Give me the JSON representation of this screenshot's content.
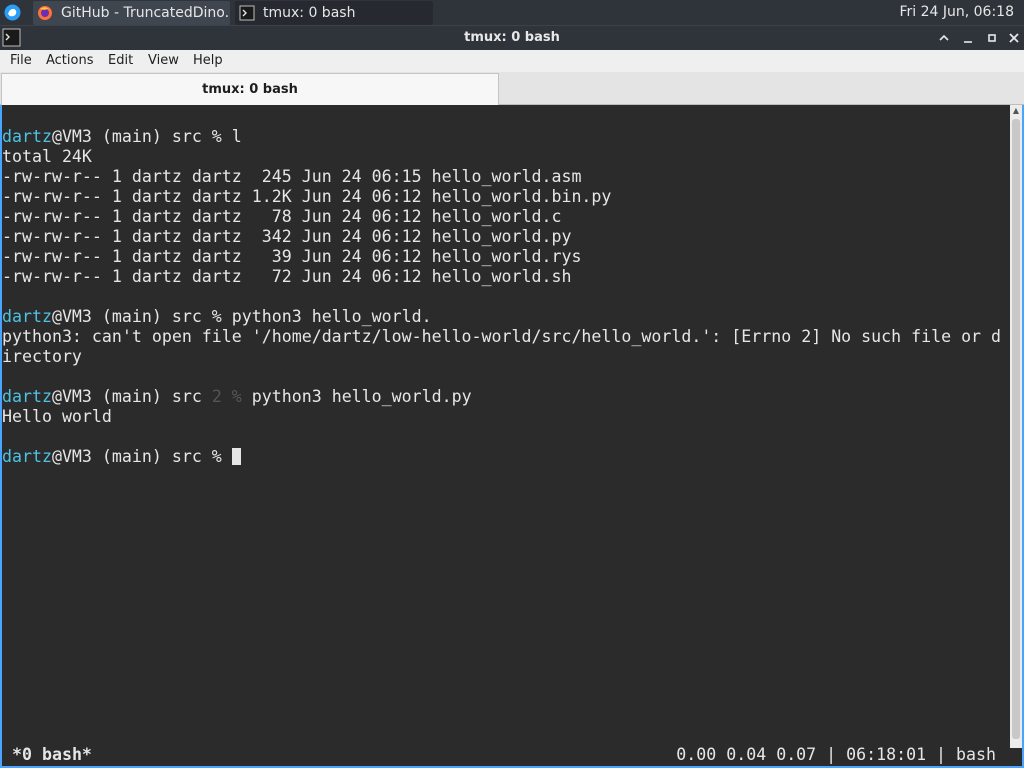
{
  "panel": {
    "tasks": [
      {
        "label": "GitHub - TruncatedDino...",
        "icon": "firefox-icon"
      },
      {
        "label": "tmux: 0 bash",
        "icon": "terminal-icon"
      }
    ],
    "clock": "Fri 24 Jun, 06:18"
  },
  "window": {
    "title": "tmux: 0 bash"
  },
  "menubar": {
    "items": [
      "File",
      "Actions",
      "Edit",
      "View",
      "Help"
    ]
  },
  "tabs": [
    {
      "label": "tmux: 0 bash",
      "active": true
    }
  ],
  "terminal": {
    "prompt_user": "dartz",
    "prompt_rest": "@VM3 (main) src % ",
    "lines": [
      {
        "kind": "prompt",
        "cmd": "l"
      },
      {
        "kind": "out",
        "text": "total 24K"
      },
      {
        "kind": "out",
        "text": "-rw-rw-r-- 1 dartz dartz  245 Jun 24 06:15 hello_world.asm"
      },
      {
        "kind": "out",
        "text": "-rw-rw-r-- 1 dartz dartz 1.2K Jun 24 06:12 hello_world.bin.py"
      },
      {
        "kind": "out",
        "text": "-rw-rw-r-- 1 dartz dartz   78 Jun 24 06:12 hello_world.c"
      },
      {
        "kind": "out",
        "text": "-rw-rw-r-- 1 dartz dartz  342 Jun 24 06:12 hello_world.py"
      },
      {
        "kind": "out",
        "text": "-rw-rw-r-- 1 dartz dartz   39 Jun 24 06:12 hello_world.rys"
      },
      {
        "kind": "out",
        "text": "-rw-rw-r-- 1 dartz dartz   72 Jun 24 06:12 hello_world.sh"
      },
      {
        "kind": "blank"
      },
      {
        "kind": "prompt",
        "cmd": "python3 hello_world."
      },
      {
        "kind": "out",
        "text": "python3: can't open file '/home/dartz/low-hello-world/src/hello_world.': [Errno 2] No such file or d"
      },
      {
        "kind": "out",
        "text": "irectory"
      },
      {
        "kind": "blank"
      },
      {
        "kind": "prompt_err",
        "mid": "@VM3 (main) src ",
        "code": "2 % ",
        "cmd": "python3 hello_world.py"
      },
      {
        "kind": "out",
        "text": "Hello world"
      },
      {
        "kind": "blank"
      },
      {
        "kind": "prompt_cursor",
        "cmd": ""
      }
    ]
  },
  "status": {
    "left": "*0 bash*",
    "right": "0.00 0.04 0.07 | 06:18:01 | bash"
  },
  "colors": {
    "prompt_user": "#4ec2e3",
    "terminal_bg": "#2b2b2b",
    "focus_border": "#4aa3ff"
  }
}
